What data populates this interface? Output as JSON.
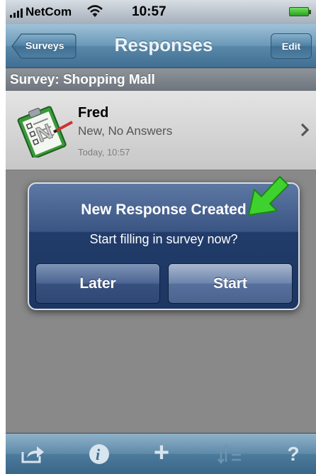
{
  "status_bar": {
    "carrier": "NetCom",
    "time": "10:57"
  },
  "nav_bar": {
    "back_label": "Surveys",
    "title": "Responses",
    "edit_label": "Edit"
  },
  "section": {
    "header": "Survey: Shopping Mall"
  },
  "list": [
    {
      "title": "Fred",
      "subtitle": "New, No Answers",
      "timestamp": "Today, 10:57"
    }
  ],
  "alert": {
    "title": "New Response Created",
    "message": "Start filling in survey now?",
    "buttons": [
      "Later",
      "Start"
    ]
  },
  "toolbar": {
    "add_glyph": "+",
    "help_glyph": "?"
  },
  "icons": [
    "signal-icon",
    "wifi-icon",
    "battery-icon",
    "clipboard-icon",
    "chevron-right-icon",
    "green-arrow-icon",
    "share-icon",
    "info-icon",
    "add-icon",
    "sort-icon",
    "help-icon"
  ],
  "colors": {
    "nav": "#5a88a8",
    "alert": "#213c6a",
    "arrow": "#3fd22e"
  }
}
